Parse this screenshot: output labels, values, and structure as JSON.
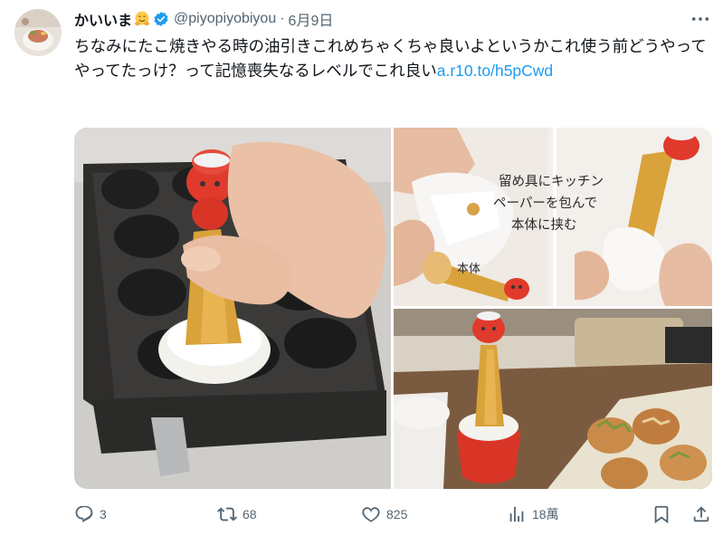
{
  "tweet": {
    "author": {
      "display_name": "かいいま",
      "handle": "@piyopiyobiyou",
      "separator": "·",
      "date": "6月9日",
      "verified": true,
      "name_emoji": "hugging-face-emoji",
      "verified_color": "#1d9bf0"
    },
    "text": {
      "body": "ちなみにたこ焼きやる時の油引きこれめちゃくちゃ良いよというかこれ使う前どうやってやってたっけ？って記憶喪失なるレベルでこれ良い",
      "link": "a.r10.to/h5pCwd",
      "link_color": "#1d9bf0"
    },
    "media": {
      "photo_top_right": {
        "caption_lines": [
          "留め具にキッチン",
          "ペーパーを包んで",
          "本体に挟む"
        ],
        "label": "本体"
      }
    },
    "actions": {
      "reply_count": "3",
      "retweet_count": "68",
      "like_count": "825",
      "view_count": "18萬"
    }
  }
}
